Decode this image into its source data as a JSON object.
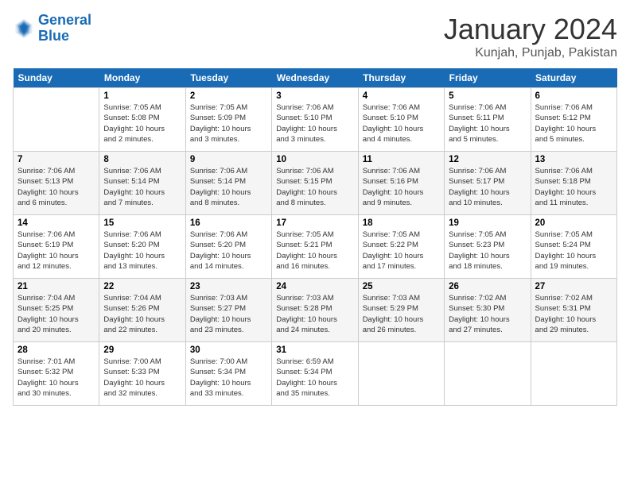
{
  "header": {
    "logo_line1": "General",
    "logo_line2": "Blue",
    "month": "January 2024",
    "location": "Kunjah, Punjab, Pakistan"
  },
  "days_of_week": [
    "Sunday",
    "Monday",
    "Tuesday",
    "Wednesday",
    "Thursday",
    "Friday",
    "Saturday"
  ],
  "weeks": [
    [
      {
        "day": "",
        "info": ""
      },
      {
        "day": "1",
        "info": "Sunrise: 7:05 AM\nSunset: 5:08 PM\nDaylight: 10 hours\nand 2 minutes."
      },
      {
        "day": "2",
        "info": "Sunrise: 7:05 AM\nSunset: 5:09 PM\nDaylight: 10 hours\nand 3 minutes."
      },
      {
        "day": "3",
        "info": "Sunrise: 7:06 AM\nSunset: 5:10 PM\nDaylight: 10 hours\nand 3 minutes."
      },
      {
        "day": "4",
        "info": "Sunrise: 7:06 AM\nSunset: 5:10 PM\nDaylight: 10 hours\nand 4 minutes."
      },
      {
        "day": "5",
        "info": "Sunrise: 7:06 AM\nSunset: 5:11 PM\nDaylight: 10 hours\nand 5 minutes."
      },
      {
        "day": "6",
        "info": "Sunrise: 7:06 AM\nSunset: 5:12 PM\nDaylight: 10 hours\nand 5 minutes."
      }
    ],
    [
      {
        "day": "7",
        "info": "Sunrise: 7:06 AM\nSunset: 5:13 PM\nDaylight: 10 hours\nand 6 minutes."
      },
      {
        "day": "8",
        "info": "Sunrise: 7:06 AM\nSunset: 5:14 PM\nDaylight: 10 hours\nand 7 minutes."
      },
      {
        "day": "9",
        "info": "Sunrise: 7:06 AM\nSunset: 5:14 PM\nDaylight: 10 hours\nand 8 minutes."
      },
      {
        "day": "10",
        "info": "Sunrise: 7:06 AM\nSunset: 5:15 PM\nDaylight: 10 hours\nand 8 minutes."
      },
      {
        "day": "11",
        "info": "Sunrise: 7:06 AM\nSunset: 5:16 PM\nDaylight: 10 hours\nand 9 minutes."
      },
      {
        "day": "12",
        "info": "Sunrise: 7:06 AM\nSunset: 5:17 PM\nDaylight: 10 hours\nand 10 minutes."
      },
      {
        "day": "13",
        "info": "Sunrise: 7:06 AM\nSunset: 5:18 PM\nDaylight: 10 hours\nand 11 minutes."
      }
    ],
    [
      {
        "day": "14",
        "info": "Sunrise: 7:06 AM\nSunset: 5:19 PM\nDaylight: 10 hours\nand 12 minutes."
      },
      {
        "day": "15",
        "info": "Sunrise: 7:06 AM\nSunset: 5:20 PM\nDaylight: 10 hours\nand 13 minutes."
      },
      {
        "day": "16",
        "info": "Sunrise: 7:06 AM\nSunset: 5:20 PM\nDaylight: 10 hours\nand 14 minutes."
      },
      {
        "day": "17",
        "info": "Sunrise: 7:05 AM\nSunset: 5:21 PM\nDaylight: 10 hours\nand 16 minutes."
      },
      {
        "day": "18",
        "info": "Sunrise: 7:05 AM\nSunset: 5:22 PM\nDaylight: 10 hours\nand 17 minutes."
      },
      {
        "day": "19",
        "info": "Sunrise: 7:05 AM\nSunset: 5:23 PM\nDaylight: 10 hours\nand 18 minutes."
      },
      {
        "day": "20",
        "info": "Sunrise: 7:05 AM\nSunset: 5:24 PM\nDaylight: 10 hours\nand 19 minutes."
      }
    ],
    [
      {
        "day": "21",
        "info": "Sunrise: 7:04 AM\nSunset: 5:25 PM\nDaylight: 10 hours\nand 20 minutes."
      },
      {
        "day": "22",
        "info": "Sunrise: 7:04 AM\nSunset: 5:26 PM\nDaylight: 10 hours\nand 22 minutes."
      },
      {
        "day": "23",
        "info": "Sunrise: 7:03 AM\nSunset: 5:27 PM\nDaylight: 10 hours\nand 23 minutes."
      },
      {
        "day": "24",
        "info": "Sunrise: 7:03 AM\nSunset: 5:28 PM\nDaylight: 10 hours\nand 24 minutes."
      },
      {
        "day": "25",
        "info": "Sunrise: 7:03 AM\nSunset: 5:29 PM\nDaylight: 10 hours\nand 26 minutes."
      },
      {
        "day": "26",
        "info": "Sunrise: 7:02 AM\nSunset: 5:30 PM\nDaylight: 10 hours\nand 27 minutes."
      },
      {
        "day": "27",
        "info": "Sunrise: 7:02 AM\nSunset: 5:31 PM\nDaylight: 10 hours\nand 29 minutes."
      }
    ],
    [
      {
        "day": "28",
        "info": "Sunrise: 7:01 AM\nSunset: 5:32 PM\nDaylight: 10 hours\nand 30 minutes."
      },
      {
        "day": "29",
        "info": "Sunrise: 7:00 AM\nSunset: 5:33 PM\nDaylight: 10 hours\nand 32 minutes."
      },
      {
        "day": "30",
        "info": "Sunrise: 7:00 AM\nSunset: 5:34 PM\nDaylight: 10 hours\nand 33 minutes."
      },
      {
        "day": "31",
        "info": "Sunrise: 6:59 AM\nSunset: 5:34 PM\nDaylight: 10 hours\nand 35 minutes."
      },
      {
        "day": "",
        "info": ""
      },
      {
        "day": "",
        "info": ""
      },
      {
        "day": "",
        "info": ""
      }
    ]
  ]
}
